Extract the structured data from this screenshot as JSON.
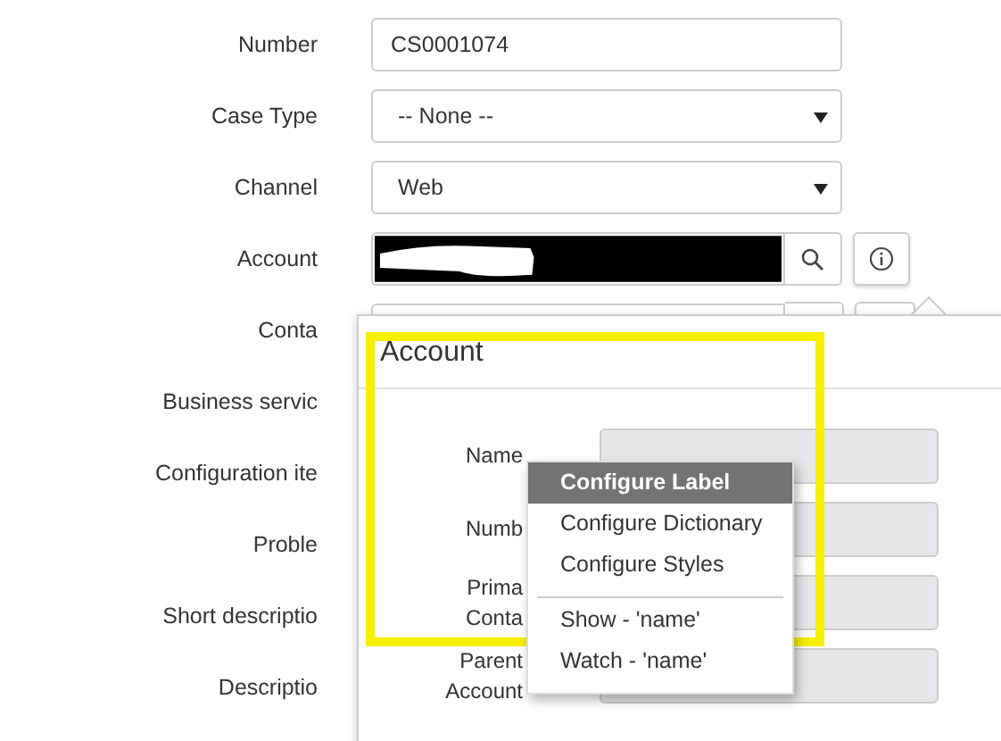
{
  "form": {
    "rows": [
      {
        "label": "Number",
        "kind": "text",
        "value": "CS0001074"
      },
      {
        "label": "Case Type",
        "kind": "select",
        "value": "-- None --"
      },
      {
        "label": "Channel",
        "kind": "select",
        "value": "Web"
      },
      {
        "label": "Account",
        "kind": "reference",
        "redacted": true
      },
      {
        "label": "Conta",
        "kind": "covered"
      },
      {
        "label": "Business servic",
        "kind": "none"
      },
      {
        "label": "Configuration ite",
        "kind": "none"
      },
      {
        "label": "Proble",
        "kind": "none"
      },
      {
        "label": "Short descriptio",
        "kind": "none"
      },
      {
        "label": "Descriptio",
        "kind": "none"
      }
    ]
  },
  "popup": {
    "title": "Account",
    "rows": [
      {
        "label": "Name"
      },
      {
        "label": "Numb"
      },
      {
        "label": "Prima\nConta"
      },
      {
        "label": "Parent\nAccount"
      }
    ]
  },
  "context_menu": {
    "items": [
      {
        "label": "Configure Label",
        "selected": true,
        "divider_before": false
      },
      {
        "label": "Configure Dictionary",
        "selected": false,
        "divider_before": false
      },
      {
        "label": "Configure Styles",
        "selected": false,
        "divider_before": false
      },
      {
        "label": "Show - 'name'",
        "selected": false,
        "divider_before": true
      },
      {
        "label": "Watch - 'name'",
        "selected": false,
        "divider_before": false
      }
    ]
  }
}
